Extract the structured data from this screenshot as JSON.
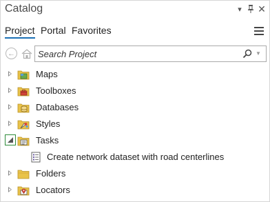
{
  "window": {
    "title": "Catalog",
    "buttons": {
      "menu": "▾",
      "pin": "ᵖ",
      "close": "✕"
    }
  },
  "tabs": [
    {
      "label": "Project",
      "active": true
    },
    {
      "label": "Portal",
      "active": false
    },
    {
      "label": "Favorites",
      "active": false
    }
  ],
  "search": {
    "placeholder": "Search Project",
    "value": ""
  },
  "tree": {
    "items": [
      {
        "label": "Maps",
        "icon": "maps-folder-icon",
        "expanded": false
      },
      {
        "label": "Toolboxes",
        "icon": "toolboxes-folder-icon",
        "expanded": false
      },
      {
        "label": "Databases",
        "icon": "databases-folder-icon",
        "expanded": false
      },
      {
        "label": "Styles",
        "icon": "styles-folder-icon",
        "expanded": false
      },
      {
        "label": "Tasks",
        "icon": "tasks-folder-icon",
        "expanded": true,
        "children": [
          {
            "label": "Create network dataset with road centerlines",
            "icon": "task-item-icon"
          }
        ]
      },
      {
        "label": "Folders",
        "icon": "folders-folder-icon",
        "expanded": false
      },
      {
        "label": "Locators",
        "icon": "locators-folder-icon",
        "expanded": false
      }
    ]
  },
  "colors": {
    "accent": "#1a6fb5",
    "folder": "#e9c34a",
    "highlight_border": "#2e8b3a"
  }
}
